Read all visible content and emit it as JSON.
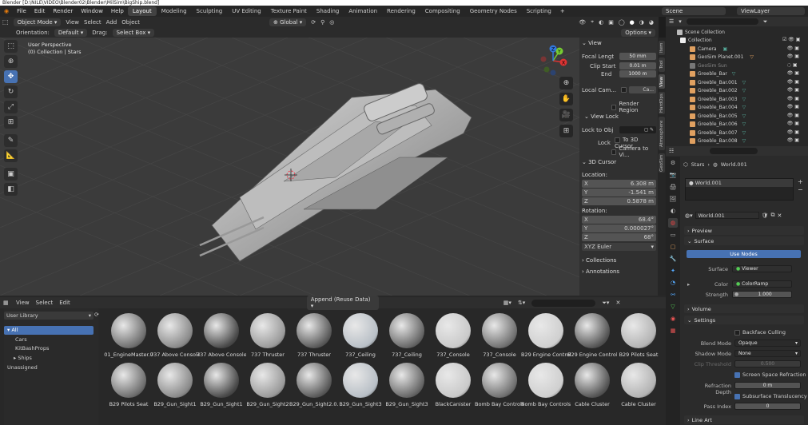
{
  "window": {
    "title": "Blender [D:\\NILE\\VIDEO\\Blender02\\Blender\\MilSim\\BigShip.blend]"
  },
  "topbar": {
    "menus": [
      "File",
      "Edit",
      "Render",
      "Window",
      "Help"
    ],
    "workspaces": [
      "Layout",
      "Modeling",
      "Sculpting",
      "UV Editing",
      "Texture Paint",
      "Shading",
      "Animation",
      "Rendering",
      "Compositing",
      "Geometry Nodes",
      "Scripting"
    ],
    "active_workspace": "Layout",
    "scene": "Scene",
    "view_layer": "ViewLayer"
  },
  "viewport_header": {
    "mode": "Object Mode",
    "menus": [
      "View",
      "Select",
      "Add",
      "Object"
    ],
    "transform_orientation": "Global",
    "orientation_label": "Orientation:",
    "orientation_value": "Default",
    "drag_label": "Drag:",
    "drag_value": "Select Box",
    "options": "Options"
  },
  "viewport": {
    "perspective": "User Perspective",
    "collection_info": "(0) Collection | Stars",
    "gizmo_axes": [
      "X",
      "Y",
      "Z"
    ]
  },
  "npanel": {
    "tabs": [
      "Item",
      "Tool",
      "View",
      "HardOps",
      "Atmosphere",
      "GeoSim"
    ],
    "active_tab": "View",
    "view_header": "View",
    "focal_length_label": "Focal Lengt",
    "focal_length": "50 mm",
    "clip_start_label": "Clip Start",
    "clip_start": "0.01 m",
    "end_label": "End",
    "end": "1000 m",
    "local_camera_label": "Local Cam...",
    "local_camera_value": "Ca...",
    "render_region": "Render Region",
    "view_lock_header": "View Lock",
    "lock_to_obj_label": "Lock to Obj",
    "lock_label": "Lock",
    "to_3d_cursor": "To 3D Cursor",
    "camera_to_view": "Camera to Vi...",
    "cursor_header": "3D Cursor",
    "location_label": "Location:",
    "loc_x_label": "X",
    "loc_x": "6.308 m",
    "loc_y_label": "Y",
    "loc_y": "-1.541 m",
    "loc_z_label": "Z",
    "loc_z": "0.5878 m",
    "rotation_label": "Rotation:",
    "rot_x_label": "X",
    "rot_x": "68.4°",
    "rot_y_label": "Y",
    "rot_y": "0.000027°",
    "rot_z_label": "Z",
    "rot_z": "68°",
    "rotation_mode": "XYZ Euler",
    "collections": "Collections",
    "annotations": "Annotations"
  },
  "outliner": {
    "scene_collection": "Scene Collection",
    "items": [
      {
        "name": "Collection",
        "color": "#cfcfcf"
      },
      {
        "name": "Camera",
        "color": "#e0a060"
      },
      {
        "name": "GeoSim Planet.001",
        "color": "#e0a060"
      },
      {
        "name": "GeoSim Sun",
        "color": "#888888"
      },
      {
        "name": "Greeble_Bar",
        "color": "#e0a060"
      },
      {
        "name": "Greeble_Bar.001",
        "color": "#e0a060"
      },
      {
        "name": "Greeble_Bar.002",
        "color": "#e0a060"
      },
      {
        "name": "Greeble_Bar.003",
        "color": "#e0a060"
      },
      {
        "name": "Greeble_Bar.004",
        "color": "#e0a060"
      },
      {
        "name": "Greeble_Bar.005",
        "color": "#e0a060"
      },
      {
        "name": "Greeble_Bar.006",
        "color": "#e0a060"
      },
      {
        "name": "Greeble_Bar.007",
        "color": "#e0a060"
      },
      {
        "name": "Greeble_Bar.008",
        "color": "#e0a060"
      }
    ]
  },
  "properties": {
    "breadcrumb_object": "Stars",
    "breadcrumb_world": "World.001",
    "world_slot": "World.001",
    "world_name": "World.001",
    "sections": {
      "preview": "Preview",
      "surface": "Surface",
      "volume": "Volume",
      "settings": "Settings",
      "line_art": "Line Art"
    },
    "use_nodes": "Use Nodes",
    "surface_label": "Surface",
    "surface_value": "Viewer",
    "color_label": "Color",
    "color_value": "ColorRamp",
    "strength_label": "Strength",
    "strength_value": "1.000",
    "backface_culling": "Backface Culling",
    "blend_mode_label": "Blend Mode",
    "blend_mode": "Opaque",
    "shadow_mode_label": "Shadow Mode",
    "shadow_mode": "None",
    "clip_threshold_label": "Clip Threshold",
    "clip_threshold": "0.500",
    "screen_space_refraction": "Screen Space Refraction",
    "refraction_depth_label": "Refraction Depth",
    "refraction_depth": "0 m",
    "subsurface_translucency": "Subsurface Translucency",
    "pass_index_label": "Pass Index",
    "pass_index": "0"
  },
  "browser": {
    "menus": [
      "View",
      "Select",
      "Edit"
    ],
    "import_mode": "Append (Reuse Data)",
    "library": "User Library",
    "catalogs": [
      "All",
      "Cars",
      "KitBashProps",
      "Ships",
      "Unassigned"
    ],
    "assets_row1": [
      "01_EngineMaster.0",
      "737 Above Console",
      "737 Above Console",
      "737 Thruster",
      "737 Thruster",
      "737_Ceiling",
      "737_Ceiling",
      "737_Console",
      "737_Console",
      "B29 Engine Controls",
      "B29 Engine Controls",
      "B29 Pilots Seat"
    ],
    "assets_row2": [
      "B29 Pilots Seat",
      "B29_Gun_Sight1",
      "B29_Gun_Sight1",
      "B29_Gun_Sight2",
      "B29_Gun_Sight2.0...",
      "B29_Gun_Sight3",
      "B29_Gun_Sight3",
      "BlackCanister",
      "Bomb Bay Controls",
      "Bomb Bay Controls",
      "Cable Cluster",
      "Cable Cluster"
    ]
  }
}
